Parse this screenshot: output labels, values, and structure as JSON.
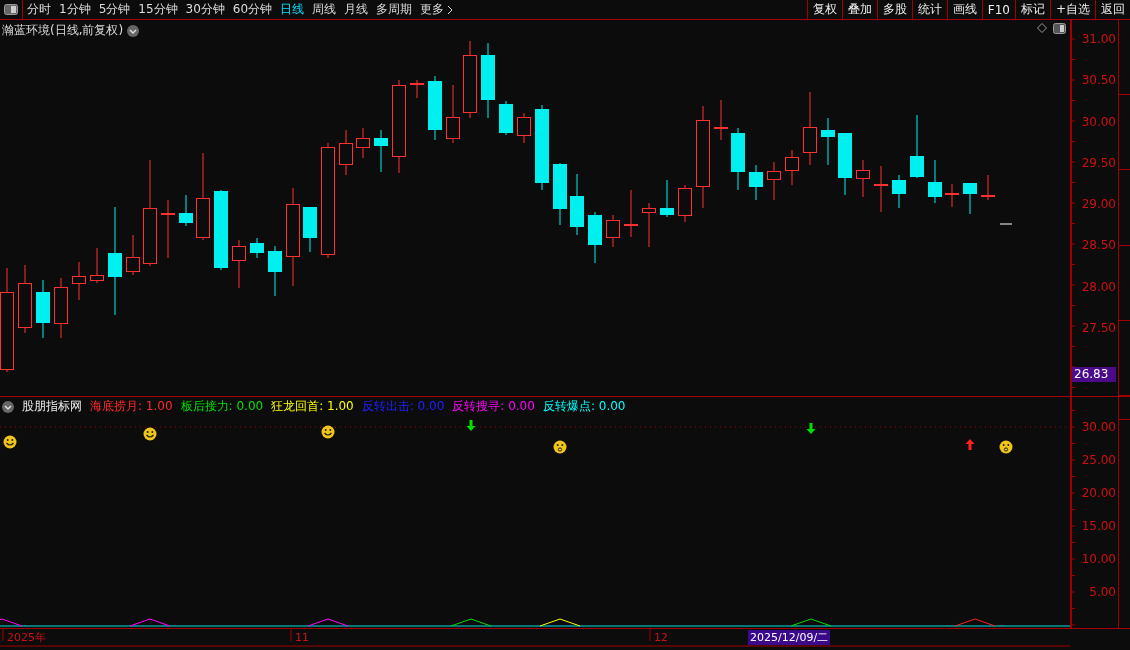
{
  "toolbar": {
    "periods": [
      {
        "label": "分时",
        "selected": false
      },
      {
        "label": "1分钟",
        "selected": false
      },
      {
        "label": "5分钟",
        "selected": false
      },
      {
        "label": "15分钟",
        "selected": false
      },
      {
        "label": "30分钟",
        "selected": false
      },
      {
        "label": "60分钟",
        "selected": false
      },
      {
        "label": "日线",
        "selected": true
      },
      {
        "label": "周线",
        "selected": false
      },
      {
        "label": "月线",
        "selected": false
      },
      {
        "label": "多周期",
        "selected": false
      },
      {
        "label": "更多",
        "selected": false
      }
    ],
    "buttons": [
      "复权",
      "叠加",
      "多股",
      "统计",
      "画线",
      "F10",
      "标记",
      "+自选",
      "返回"
    ]
  },
  "chart": {
    "title": "瀚蓝环境(日线,前复权)",
    "y_labels": [
      "31.00",
      "30.50",
      "30.00",
      "29.50",
      "29.00",
      "28.50",
      "28.00",
      "27.50"
    ],
    "price_tag": "26.83"
  },
  "indicator": {
    "name": "股朋指标网",
    "legend": [
      {
        "text": "海底捞月: 1.00",
        "color": "#ff2a2a"
      },
      {
        "text": "板后接力: 0.00",
        "color": "#00e000"
      },
      {
        "text": "狂龙回首: 1.00",
        "color": "#ffff00"
      },
      {
        "text": "反转出击: 0.00",
        "color": "#2020ff"
      },
      {
        "text": "反转搜寻: 0.00",
        "color": "#ff00ff"
      },
      {
        "text": "反转爆点: 0.00",
        "color": "#00ffff"
      }
    ],
    "y_labels": [
      "30.00",
      "25.00",
      "20.00",
      "15.00",
      "10.00",
      "5.00"
    ],
    "signals": [
      {
        "kind": "smile",
        "color": "#f0c419"
      },
      {
        "kind": "smile",
        "color": "#f0c419"
      },
      {
        "kind": "smile",
        "color": "#f0c419"
      },
      {
        "kind": "down-arrow",
        "color": "#00e000"
      },
      {
        "kind": "surprised",
        "color": "#f0c419"
      },
      {
        "kind": "down-arrow",
        "color": "#00e000"
      },
      {
        "kind": "up-arrow",
        "color": "#ff2020"
      },
      {
        "kind": "surprised",
        "color": "#f0c419"
      }
    ]
  },
  "time_axis": {
    "labels": [
      "2025年",
      "11",
      "12"
    ],
    "cursor_date": "2025/12/09/二"
  }
}
